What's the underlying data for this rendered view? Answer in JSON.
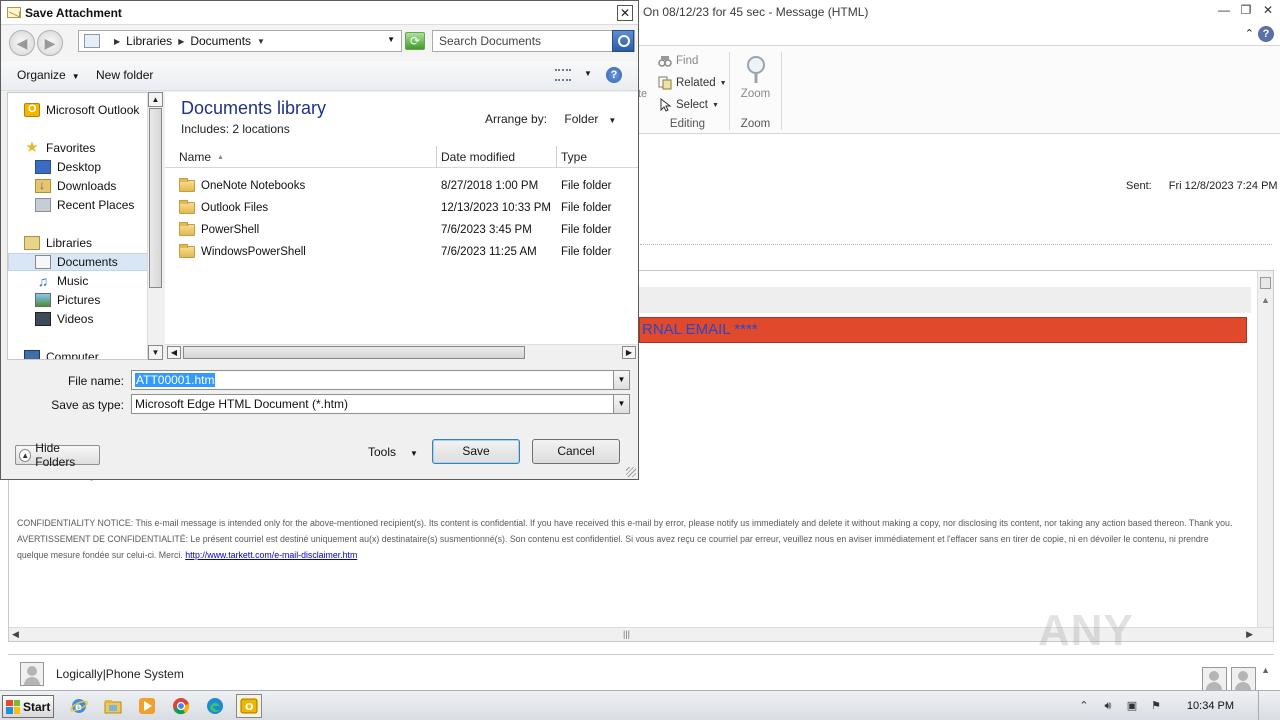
{
  "background_window": {
    "title": "On 08/12/23 for 45 sec  -  Message (HTML)",
    "ribbon": {
      "partial_label": "te",
      "editing": {
        "find": "Find",
        "related": "Related",
        "select": "Select",
        "group_label": "Editing"
      },
      "zoom": {
        "button": "Zoom",
        "group_label": "Zoom"
      }
    },
    "sent_label": "Sent:",
    "sent_value": "Fri 12/8/2023 7:24 PM",
    "banner_text": "RNAL EMAIL ****",
    "confidentiality_text": "CONFIDENTIALITY NOTICE: This e-mail message is intended only for the above-mentioned recipient(s). Its content is confidential. If you have received this e-mail by error, please notify us immediately and delete it without making a copy, nor disclosing its content, nor taking any action based thereon. Thank you. AVERTISSEMENT DE CONFIDENTIALITÉ: Le présent courriel est destiné uniquement au(x) destinataire(s) susmentionné(s). Son contenu est confidentiel. Si vous avez reçu ce courriel par erreur, veuillez nous en aviser immédiatement et l'effacer sans en tirer de copie, ni en dévoiler le contenu, ni prendre quelque mesure fondée sur celui-ci. Merci.",
    "confidentiality_link": "http://www.tarkett.com/e-mail-disclaimer.htm",
    "people_name": "Logically|Phone System",
    "watermark": "ANY RUN"
  },
  "dialog": {
    "title": "Save Attachment",
    "close": "✕",
    "breadcrumb": [
      "Libraries",
      "Documents"
    ],
    "search_placeholder": "Search Documents",
    "toolbar": {
      "organize": "Organize",
      "new_folder": "New folder",
      "help": "?"
    },
    "nav_items": [
      {
        "label": "Microsoft Outlook",
        "icon": "outlook-icon"
      },
      {
        "label": "Favorites",
        "icon": "star-icon"
      },
      {
        "label": "Desktop",
        "icon": "desktop-icon"
      },
      {
        "label": "Downloads",
        "icon": "downloads-icon"
      },
      {
        "label": "Recent Places",
        "icon": "recent-places-icon"
      },
      {
        "label": "Libraries",
        "icon": "libraries-icon"
      },
      {
        "label": "Documents",
        "icon": "documents-icon",
        "selected": true
      },
      {
        "label": "Music",
        "icon": "music-icon"
      },
      {
        "label": "Pictures",
        "icon": "pictures-icon"
      },
      {
        "label": "Videos",
        "icon": "videos-icon"
      },
      {
        "label": "Computer",
        "icon": "computer-icon"
      }
    ],
    "library": {
      "title": "Documents library",
      "includes": "Includes:  2 locations",
      "arrange_label": "Arrange by:",
      "arrange_value": "Folder"
    },
    "columns": {
      "name": "Name",
      "date": "Date modified",
      "type": "Type"
    },
    "files": [
      {
        "name": "OneNote Notebooks",
        "date": "8/27/2018 1:00 PM",
        "type": "File folder"
      },
      {
        "name": "Outlook Files",
        "date": "12/13/2023 10:33 PM",
        "type": "File folder"
      },
      {
        "name": "PowerShell",
        "date": "7/6/2023 3:45 PM",
        "type": "File folder"
      },
      {
        "name": "WindowsPowerShell",
        "date": "7/6/2023 11:25 AM",
        "type": "File folder"
      }
    ],
    "file_name_label": "File name:",
    "file_name_value": "ATT00001.htm",
    "save_type_label": "Save as type:",
    "save_type_value": "Microsoft Edge HTML Document (*.htm)",
    "hide_folders": "Hide Folders",
    "tools": "Tools",
    "save": "Save",
    "cancel": "Cancel"
  },
  "taskbar": {
    "start": "Start",
    "apps": [
      "internet-explorer-icon",
      "file-explorer-icon",
      "media-player-icon",
      "chrome-icon",
      "edge-icon",
      "outlook-icon"
    ],
    "clock": "10:34 PM"
  }
}
